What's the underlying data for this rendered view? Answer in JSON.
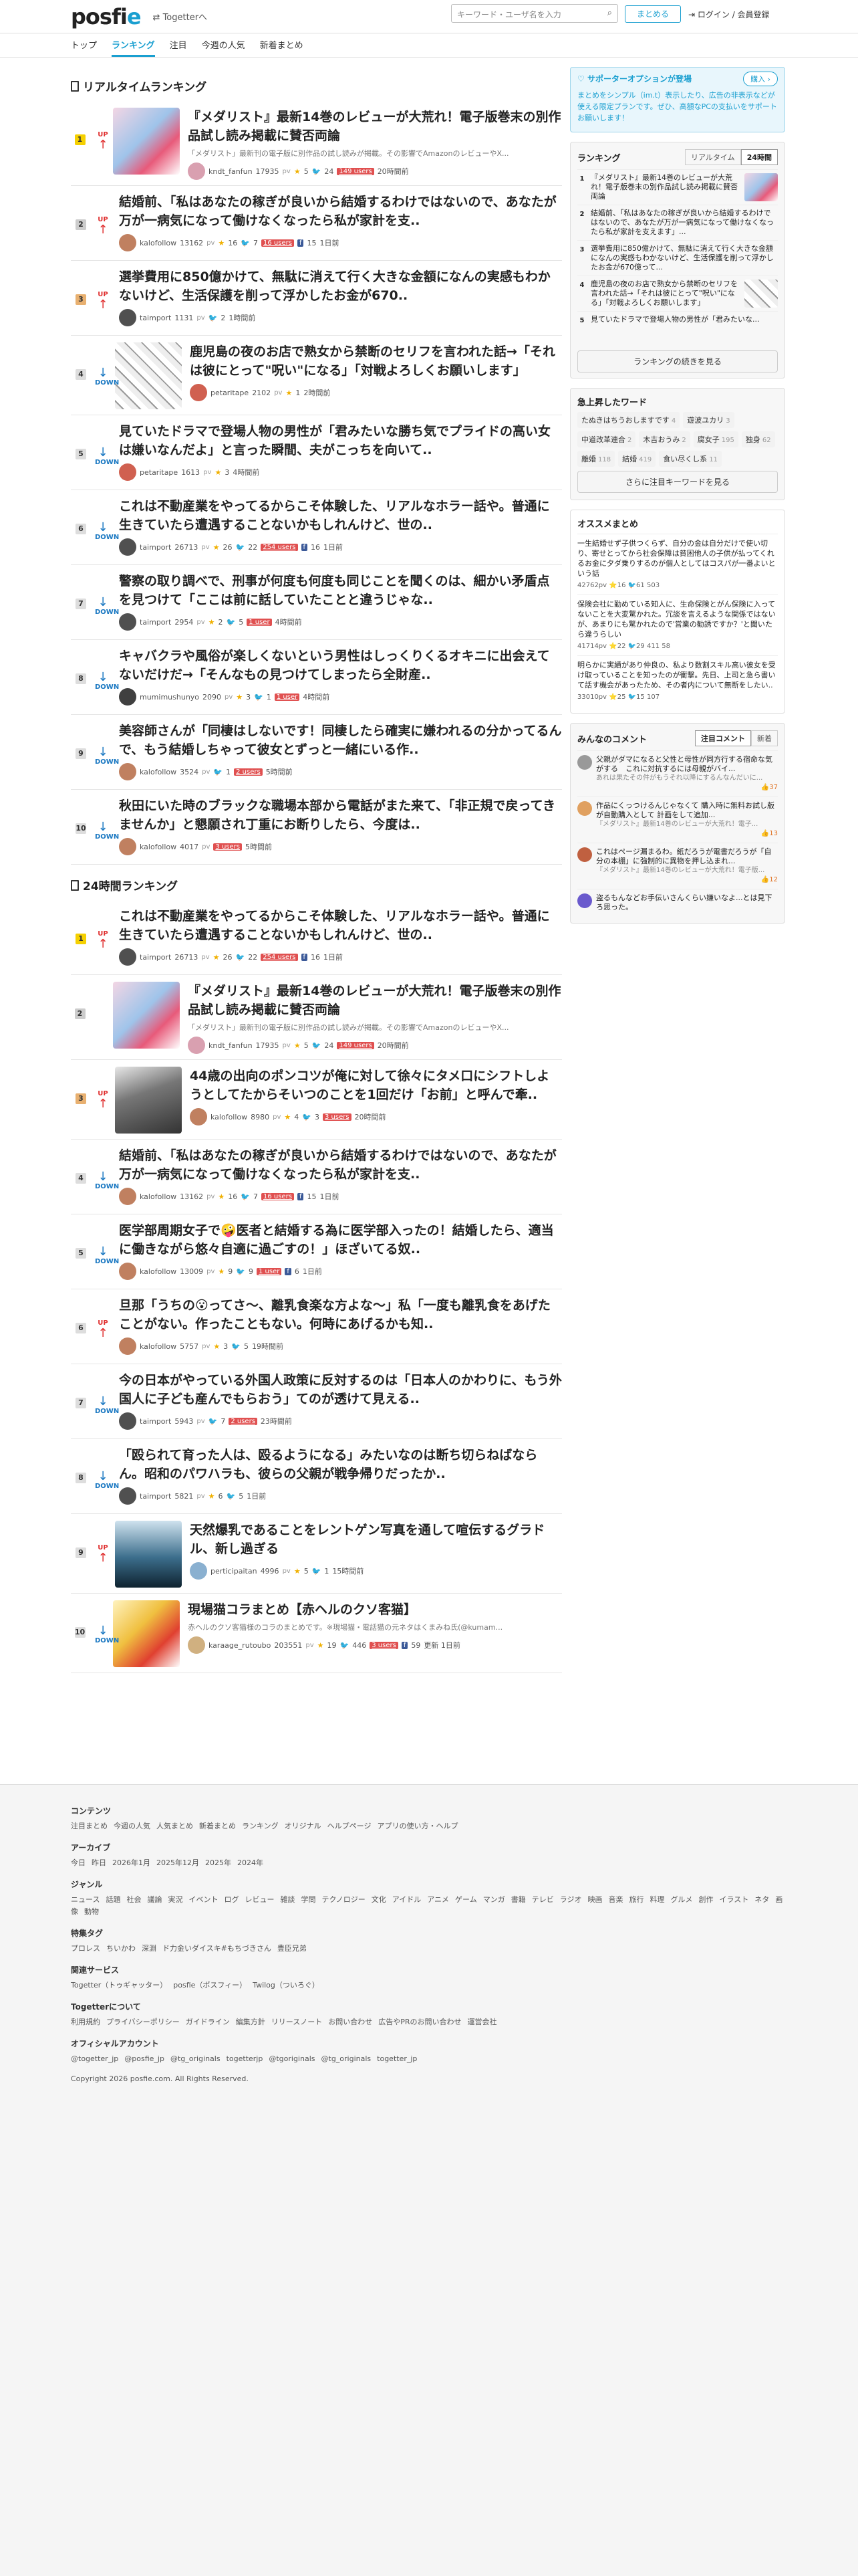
{
  "header": {
    "logo": "posfie",
    "togetter_link": "Togetterへ",
    "search_placeholder": "キーワード・ユーザ名を入力",
    "matome_button": "まとめる",
    "login": "ログイン / 会員登録"
  },
  "nav": [
    "トップ",
    "ランキング",
    "注目",
    "今週の人気",
    "新着まとめ"
  ],
  "realtime": {
    "heading": "リアルタイムランキング",
    "items": [
      {
        "rank": "1",
        "trend": "UP",
        "title": "『メダリスト』最新14巻のレビューが大荒れ！電子版巻末の別作品試し読み掲載に賛否両論",
        "sub": "「メダリスト」最新刊の電子版に別作品の試し読みが掲載。その影響でAmazonのレビューやX...",
        "user": "kndt_fanfun",
        "pv": "17935",
        "pvu": "pv",
        "stars": "5",
        "tweets": "24",
        "hatena": "149 users",
        "fb": "",
        "time": "20時間前",
        "avatar": "#d9a0b0",
        "thumb": "t1"
      },
      {
        "rank": "2",
        "trend": "UP",
        "title": "結婚前、「私はあなたの稼ぎが良いから結婚するわけではないので、あなたが万が一病気になって働けなくなったら私が家計を支..",
        "sub": "",
        "user": "kalofollow",
        "pv": "13162",
        "pvu": "pv",
        "stars": "16",
        "tweets": "7",
        "hatena": "16 users",
        "fb": "15",
        "time": "1日前",
        "avatar": "#c08060",
        "thumb": ""
      },
      {
        "rank": "3",
        "trend": "UP",
        "title": "選挙費用に850億かけて、無駄に消えて行く大きな金額になんの実感もわかないけど、生活保護を削って浮かしたお金が670..",
        "sub": "",
        "user": "taimport",
        "pv": "1131",
        "pvu": "pv",
        "stars": "",
        "tweets": "2",
        "hatena": "",
        "fb": "",
        "time": "1時間前",
        "avatar": "#505050",
        "thumb": ""
      },
      {
        "rank": "4",
        "trend": "DOWN",
        "title": "鹿児島の夜のお店で熟女から禁断のセリフを言われた話→「それは彼にとって\"呪い\"になる」「対戦よろしくお願いします」",
        "sub": "",
        "user": "petaritape",
        "pv": "2102",
        "pvu": "pv",
        "stars": "1",
        "tweets": "",
        "hatena": "",
        "fb": "",
        "time": "2時間前",
        "avatar": "#d06050",
        "thumb": "t4"
      },
      {
        "rank": "5",
        "trend": "DOWN",
        "title": "見ていたドラマで登場人物の男性が「君みたいな勝ち気でプライドの高い女は嫌いなんだよ」と言った瞬間、夫がこっちを向いて..",
        "sub": "",
        "user": "petaritape",
        "pv": "1613",
        "pvu": "pv",
        "stars": "3",
        "tweets": "",
        "hatena": "",
        "fb": "",
        "time": "4時間前",
        "avatar": "#d06050",
        "thumb": ""
      },
      {
        "rank": "6",
        "trend": "DOWN",
        "title": "これは不動産業をやってるからこそ体験した、リアルなホラー話や。普通に生きていたら遭遇することないかもしれんけど、世の..",
        "sub": "",
        "user": "taimport",
        "pv": "26713",
        "pvu": "pv",
        "stars": "26",
        "tweets": "22",
        "hatena": "254 users",
        "fb": "16",
        "time": "1日前",
        "avatar": "#505050",
        "thumb": ""
      },
      {
        "rank": "7",
        "trend": "DOWN",
        "title": "警察の取り調べで、刑事が何度も何度も同じことを聞くのは、細かい矛盾点を見つけて「ここは前に話していたことと違うじゃな..",
        "sub": "",
        "user": "taimport",
        "pv": "2954",
        "pvu": "pv",
        "stars": "2",
        "tweets": "5",
        "hatena": "1 user",
        "fb": "",
        "time": "4時間前",
        "avatar": "#505050",
        "thumb": ""
      },
      {
        "rank": "8",
        "trend": "DOWN",
        "title": "キャバクラや風俗が楽しくないという男性はしっくりくるオキニに出会えてないだけだ→「そんなもの見つけてしまったら全財産..",
        "sub": "",
        "user": "mumimushunyo",
        "pv": "2090",
        "pvu": "pv",
        "stars": "3",
        "tweets": "1",
        "hatena": "1 user",
        "fb": "",
        "time": "4時間前",
        "avatar": "#404040",
        "thumb": ""
      },
      {
        "rank": "9",
        "trend": "DOWN",
        "title": "美容師さんが「同棲はしないです！同棲したら確実に嫌われるの分かってるんで、もう結婚しちゃって彼女とずっと一緒にいる作..",
        "sub": "",
        "user": "kalofollow",
        "pv": "3524",
        "pvu": "pv",
        "stars": "",
        "tweets": "1",
        "hatena": "2 users",
        "fb": "",
        "time": "5時間前",
        "avatar": "#c08060",
        "thumb": ""
      },
      {
        "rank": "10",
        "trend": "DOWN",
        "title": "秋田にいた時のブラックな職場本部から電話がまた来て、「非正規で戻ってきませんか」と懇願され丁重にお断りしたら、今度は..",
        "sub": "",
        "user": "kalofollow",
        "pv": "4017",
        "pvu": "pv",
        "stars": "",
        "tweets": "",
        "hatena": "3 users",
        "fb": "",
        "time": "5時間前",
        "avatar": "#c08060",
        "thumb": ""
      }
    ]
  },
  "daily": {
    "heading": "24時間ランキング",
    "items": [
      {
        "rank": "1",
        "trend": "UP",
        "title": "これは不動産業をやってるからこそ体験した、リアルなホラー話や。普通に生きていたら遭遇することないかもしれんけど、世の..",
        "sub": "",
        "user": "taimport",
        "pv": "26713",
        "pvu": "pv",
        "stars": "26",
        "tweets": "22",
        "hatena": "254 users",
        "fb": "16",
        "time": "1日前",
        "avatar": "#505050",
        "thumb": ""
      },
      {
        "rank": "2",
        "trend": "",
        "title": "『メダリスト』最新14巻のレビューが大荒れ！電子版巻末の別作品試し読み掲載に賛否両論",
        "sub": "「メダリスト」最新刊の電子版に別作品の試し読みが掲載。その影響でAmazonのレビューやX...",
        "user": "kndt_fanfun",
        "pv": "17935",
        "pvu": "pv",
        "stars": "5",
        "tweets": "24",
        "hatena": "149 users",
        "fb": "",
        "time": "20時間前",
        "avatar": "#d9a0b0",
        "thumb": "t1"
      },
      {
        "rank": "3",
        "trend": "UP",
        "title": "44歳の出向のポンコツが俺に対して徐々にタメ口にシフトしようとしてたからそいつのことを1回だけ「お前」と呼んで牽..",
        "sub": "",
        "user": "kalofollow",
        "pv": "8980",
        "pvu": "pv",
        "stars": "4",
        "tweets": "3",
        "hatena": "3 users",
        "fb": "",
        "time": "20時間前",
        "avatar": "#c08060",
        "thumb": "t3"
      },
      {
        "rank": "4",
        "trend": "DOWN",
        "title": "結婚前、「私はあなたの稼ぎが良いから結婚するわけではないので、あなたが万が一病気になって働けなくなったら私が家計を支..",
        "sub": "",
        "user": "kalofollow",
        "pv": "13162",
        "pvu": "pv",
        "stars": "16",
        "tweets": "7",
        "hatena": "16 users",
        "fb": "15",
        "time": "1日前",
        "avatar": "#c08060",
        "thumb": ""
      },
      {
        "rank": "5",
        "trend": "DOWN",
        "title": "医学部周期女子で🤪医者と結婚する為に医学部入ったの！結婚したら、適当に働きながら悠々自適に過ごすの！」ほざいてる奴..",
        "sub": "",
        "user": "kalofollow",
        "pv": "13009",
        "pvu": "pv",
        "stars": "9",
        "tweets": "9",
        "hatena": "1 user",
        "fb": "6",
        "time": "1日前",
        "avatar": "#c08060",
        "thumb": ""
      },
      {
        "rank": "6",
        "trend": "UP",
        "title": "旦那「うちの😮ってさ〜、離乳食楽な方よな〜」私「一度も離乳食をあげたことがない。作ったこともない。何時にあげるかも知..",
        "sub": "",
        "user": "kalofollow",
        "pv": "5757",
        "pvu": "pv",
        "stars": "3",
        "tweets": "5",
        "hatena": "",
        "fb": "",
        "time": "19時間前",
        "avatar": "#c08060",
        "thumb": ""
      },
      {
        "rank": "7",
        "trend": "DOWN",
        "title": "今の日本がやっている外国人政策に反対するのは「日本人のかわりに、もう外国人に子ども産んでもらおう」てのが透けて見える..",
        "sub": "",
        "user": "taimport",
        "pv": "5943",
        "pvu": "pv",
        "stars": "",
        "tweets": "7",
        "hatena": "2 users",
        "fb": "",
        "time": "23時間前",
        "avatar": "#505050",
        "thumb": ""
      },
      {
        "rank": "8",
        "trend": "DOWN",
        "title": "「殴られて育った人は、殴るようになる」みたいなのは断ち切らねばならん。昭和のパワハラも、彼らの父親が戦争帰りだったか..",
        "sub": "",
        "user": "taimport",
        "pv": "5821",
        "pvu": "pv",
        "stars": "6",
        "tweets": "5",
        "hatena": "",
        "fb": "",
        "time": "1日前",
        "avatar": "#505050",
        "thumb": ""
      },
      {
        "rank": "9",
        "trend": "UP",
        "title": "天然爆乳であることをレントゲン写真を通して喧伝するグラドル、新し過ぎる",
        "sub": "",
        "user": "perticipaitan",
        "pv": "4996",
        "pvu": "pv",
        "stars": "5",
        "tweets": "1",
        "hatena": "",
        "fb": "",
        "time": "15時間前",
        "avatar": "#8ab0d0",
        "thumb": "t9"
      },
      {
        "rank": "10",
        "trend": "DOWN",
        "title": "現場猫コラまとめ【赤ヘルのクソ客猫】",
        "sub": "赤ヘルのクソ客猫様のコラのまとめです。※現場猫・電話猫の元ネタはくまみね氏(@kumam...",
        "user": "karaage_rutoubo",
        "pv": "203551",
        "pvu": "pv",
        "stars": "19",
        "tweets": "446",
        "hatena": "3 users",
        "fb": "59",
        "time": "更新 1日前",
        "avatar": "#d0b080",
        "thumb": "t10"
      }
    ]
  },
  "sidebar": {
    "support_title": "サポーターオプションが登場",
    "support_desc": "まとめをシンプル（im.t）表示したり、広告の非表示などが使える限定プランです。ぜひ、高額なPCの支払いをサポートお願いします！",
    "support_button": "購入 ›",
    "ranking_title": "ランキング",
    "tab_realtime": "リアルタイム",
    "tab_24h": "24時間",
    "ranking_rows": [
      {
        "n": "1",
        "text": "『メダリスト』最新14巻のレビューが大荒れ！電子版巻末の別作品試し読み掲載に賛否両論"
      },
      {
        "n": "2",
        "text": "結婚前、「私はあなたの稼ぎが良いから結婚するわけではないので、あなたが万が一病気になって働けなくなったら私が家計を支えます」..."
      },
      {
        "n": "3",
        "text": "選挙費用に850億かけて、無駄に消えて行く大きな金額になんの実感もわかないけど、生活保護を削って浮かしたお金が670億って..."
      },
      {
        "n": "4",
        "text": "鹿児島の夜のお店で熟女から禁断のセリフを言われた話→「それは彼にとって\"呪い\"になる」「対戦よろしくお願いします」"
      },
      {
        "n": "5",
        "text": "見ていたドラマで登場人物の男性が「君みたいな..."
      }
    ],
    "ranking_more": "ランキングの続きを見る",
    "kw_title": "急上昇したワード",
    "keywords": [
      {
        "w": "たぬきはちうおしますです",
        "c": "4"
      },
      {
        "w": "遊波ユカリ",
        "c": "3"
      },
      {
        "w": "中道改革連合",
        "c": "2"
      },
      {
        "w": "木吉おうみ",
        "c": "2"
      },
      {
        "w": "腐女子",
        "c": "195"
      },
      {
        "w": "独身",
        "c": "62"
      },
      {
        "w": "離婚",
        "c": "118"
      },
      {
        "w": "結婚",
        "c": "419"
      },
      {
        "w": "食い尽くし系",
        "c": "11"
      }
    ],
    "kw_more": "さらに注目キーワードを見る",
    "rec_title": "オススメまとめ",
    "recs": [
      {
        "text": "一生結婚せず子供つくらず、自分の金は自分だけで使い切り、寄せとってから社会保障は貧困他人の子供が払ってくれるお金に夕ダ乗りするのが個人としてはコスパが一番よいという話",
        "meta": "42762pv ⭐16 🐦61 503"
      },
      {
        "text": "保険会社に勤めている知人に、生命保険とがん保険に入ってないことを大変驚かれた。冗談を言えるような関係ではないが、あまりにも驚かれたので'営業の勧誘ですか？'と聞いたら違うらしい",
        "meta": "41714pv ⭐22 🐦29 411 58"
      },
      {
        "text": "明らかに実績があり仲良の、私より数割スキル高い彼女を受け取っていることを知ったのが衝撃。先日、上司と急ら書いて話す機会があったため、その者内について無断をしたい..",
        "meta": "33010pv ⭐25 🐦15 107"
      }
    ],
    "cmt_title": "みんなのコメント",
    "cmt_tab1": "注目コメント",
    "cmt_tab2": "新着",
    "comments": [
      {
        "text": "父親がダマになると父性と母性が同方行する宿命な気がする　これに対抗するには母親がバイ...",
        "src": "あれは果たその件がもうそれ以降にするんなんだいに...",
        "likes": "37"
      },
      {
        "text": "作品にくっつけるんじゃなくて 購入時に無料お試し版が自動購入として 計画をして追加...",
        "src": "『メダリスト』最新14巻のレビューが大荒れ！電子...",
        "likes": "13"
      },
      {
        "text": "これはページ漏まるわ。紙だろうが電書だろうが「自分の本棚」に強制的に異物を押し込まれ...",
        "src": "『メダリスト』最新14巻のレビューが大荒れ！電子版...",
        "likes": "12"
      },
      {
        "text": "盗るもんなどお手伝いさんくらい嫌いなよ...とは見下ろ思った。",
        "src": "",
        "likes": ""
      }
    ]
  },
  "footer": {
    "sections": [
      {
        "h": "コンテンツ",
        "links": [
          "注目まとめ",
          "今週の人気",
          "人気まとめ",
          "新着まとめ",
          "ランキング",
          "オリジナル",
          "ヘルプページ",
          "アプリの使い方・ヘルプ"
        ]
      },
      {
        "h": "アーカイブ",
        "links": [
          "今日",
          "昨日",
          "2026年1月",
          "2025年12月",
          "2025年",
          "2024年"
        ]
      },
      {
        "h": "ジャンル",
        "links": [
          "ニュース",
          "話題",
          "社会",
          "議論",
          "実況",
          "イベント",
          "ログ",
          "レビュー",
          "雑談",
          "学問",
          "テクノロジー",
          "文化",
          "アイドル",
          "アニメ",
          "ゲーム",
          "マンガ",
          "書籍",
          "テレビ",
          "ラジオ",
          "映画",
          "音楽",
          "旅行",
          "料理",
          "グルメ",
          "創作",
          "イラスト",
          "ネタ",
          "画像",
          "動物"
        ]
      },
      {
        "h": "特集タグ",
        "links": [
          "プロレス",
          "ちいかわ",
          "深淵",
          "ド力金いダイスキ#もちづきさん",
          "豊臣兄弟"
        ]
      },
      {
        "h": "関連サービス",
        "links": [
          "Togetter（トゥギャッター）",
          "posfie（ポスフィー）",
          "Twilog（ついろぐ）"
        ]
      },
      {
        "h": "Togetterについて",
        "links": [
          "利用規約",
          "プライバシーポリシー",
          "ガイドライン",
          "編集方針",
          "リリースノート",
          "お問い合わせ",
          "広告やPRのお問い合わせ",
          "運営会社"
        ]
      },
      {
        "h": "オフィシャルアカウント",
        "links": [
          "@togetter_jp",
          "@posfie_jp",
          "@tg_originals",
          "togetterjp",
          "@tgoriginals",
          "@tg_originals",
          "togetter_jp"
        ]
      }
    ],
    "copyright": "Copyright 2026 posfie.com. All Rights Reserved."
  }
}
